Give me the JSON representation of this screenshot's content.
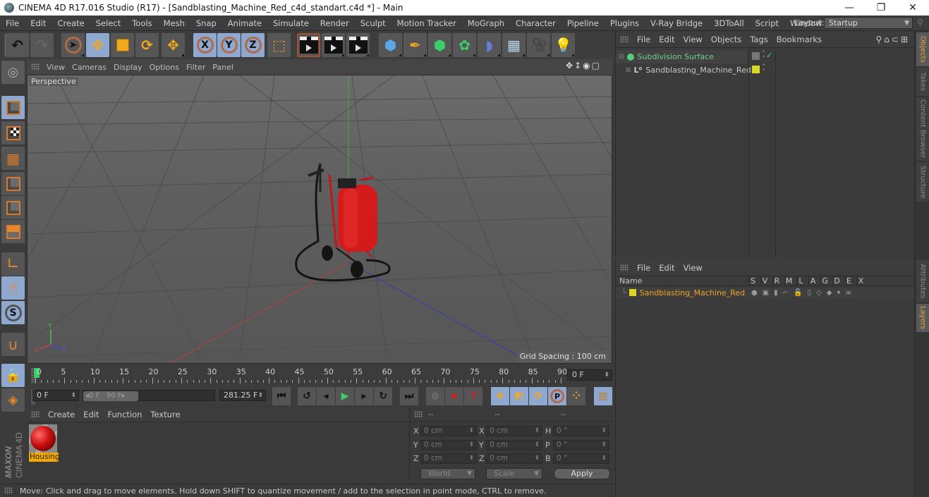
{
  "titlebar": {
    "title": "CINEMA 4D R17.016 Studio (R17) - [Sandblasting_Machine_Red_c4d_standart.c4d *] - Main",
    "minimize": "—",
    "restore": "❐",
    "close": "✕"
  },
  "menubar": {
    "items": [
      "File",
      "Edit",
      "Create",
      "Select",
      "Tools",
      "Mesh",
      "Snap",
      "Animate",
      "Simulate",
      "Render",
      "Sculpt",
      "Motion Tracker",
      "MoGraph",
      "Character",
      "Pipeline",
      "Plugins",
      "V-Ray Bridge",
      "3DToAll",
      "Script",
      "Window",
      "Help"
    ],
    "layout_label": "Layout:",
    "layout_value": "Startup"
  },
  "toolbar": {
    "buttons": [
      "undo",
      "redo",
      "live-selection",
      "move",
      "scale",
      "rotate",
      "recent-tool",
      "x-axis",
      "y-axis",
      "z-axis",
      "coordinate-system",
      "render-view",
      "render-picture-viewer",
      "render-settings",
      "cube",
      "pen",
      "subdivision",
      "cloner",
      "deformer",
      "floor",
      "camera",
      "light"
    ],
    "axis_labels": [
      "X",
      "Y",
      "Z"
    ]
  },
  "viewport": {
    "menu": [
      "View",
      "Cameras",
      "Display",
      "Options",
      "Filter",
      "Panel"
    ],
    "camera_label": "Perspective",
    "grid_spacing": "Grid Spacing : 100 cm",
    "axis_labels": [
      "Y",
      "X",
      "Z"
    ]
  },
  "timeline": {
    "ticks": [
      "0",
      "5",
      "10",
      "15",
      "20",
      "25",
      "30",
      "35",
      "40",
      "45",
      "50",
      "55",
      "60",
      "65",
      "70",
      "75",
      "80",
      "85",
      "90"
    ],
    "current_frame": "0 F",
    "start_field": "0 F",
    "range_start": "0 F",
    "range_end": "90 F",
    "fps_field": "281.25 F"
  },
  "material_manager": {
    "menu": [
      "Create",
      "Edit",
      "Function",
      "Texture"
    ],
    "materials": [
      {
        "name": "Housing"
      }
    ]
  },
  "coordinates": {
    "headers": [
      "--",
      "--",
      "--"
    ],
    "rows": [
      {
        "pos_label": "X",
        "pos": "0 cm",
        "size_label": "X",
        "size": "0 cm",
        "rot_label": "H",
        "rot": "0 °"
      },
      {
        "pos_label": "Y",
        "pos": "0 cm",
        "size_label": "Y",
        "size": "0 cm",
        "rot_label": "P",
        "rot": "0 °"
      },
      {
        "pos_label": "Z",
        "pos": "0 cm",
        "size_label": "Z",
        "size": "0 cm",
        "rot_label": "B",
        "rot": "0 °"
      }
    ],
    "mode": "World",
    "transform": "Scale",
    "apply": "Apply"
  },
  "status": {
    "text": "Move: Click and drag to move elements. Hold down SHIFT to quantize movement / add to the selection in point mode, CTRL to remove."
  },
  "object_manager": {
    "menu": [
      "File",
      "Edit",
      "View",
      "Objects",
      "Tags",
      "Bookmarks"
    ],
    "objects": [
      {
        "name": "Subdivision Surface",
        "color": "#4fd07a"
      },
      {
        "name": "Sandblasting_Machine_Red",
        "color": "#d8d820"
      }
    ]
  },
  "layer_manager": {
    "menu": [
      "File",
      "Edit",
      "View"
    ],
    "columns": [
      "Name",
      "S",
      "V",
      "R",
      "M",
      "L",
      "A",
      "G",
      "D",
      "E",
      "X"
    ],
    "layers": [
      {
        "name": "Sandblasting_Machine_Red",
        "color": "#e0d020"
      }
    ]
  },
  "side_tabs": {
    "top": [
      "Objects",
      "Takes",
      "Content Browser",
      "Structure"
    ],
    "bottom": [
      "Attributes",
      "Layers"
    ]
  },
  "brand": {
    "maxon": "MAXON",
    "product": "CINEMA 4D"
  },
  "colors": {
    "selected_blue": "#8fa8cf",
    "accent_orange": "#e8a23a",
    "layer_yellow": "#e0d020"
  }
}
